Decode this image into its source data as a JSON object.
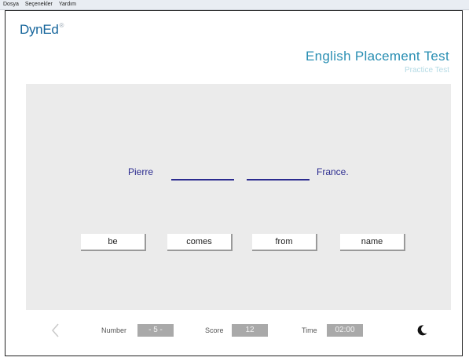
{
  "menu": [
    "Dosya",
    "Seçenekler",
    "Yardım"
  ],
  "brand": {
    "logo": "DynEd",
    "mark": "®"
  },
  "header": {
    "title": "English Placement Test",
    "subtitle": "Practice Test"
  },
  "question": {
    "word_start": "Pierre",
    "word_end": "France."
  },
  "options": [
    "be",
    "comes",
    "from",
    "name"
  ],
  "footer": {
    "number_label": "Number",
    "number_value": "- 5 -",
    "score_label": "Score",
    "score_value": "12",
    "time_label": "Time",
    "time_value": "02:00"
  },
  "icons": {
    "back": "chevron-left-icon",
    "timer": "moon-icon"
  },
  "colors": {
    "brand": "#15659b",
    "title": "#2a8fb3",
    "sentence": "#2b2b8f",
    "panel": "#ebebeb"
  }
}
